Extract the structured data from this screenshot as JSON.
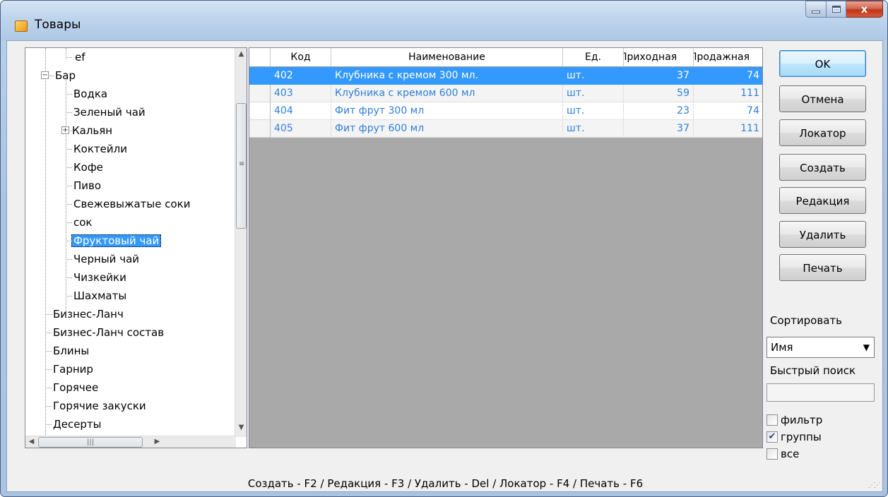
{
  "window": {
    "title": "Товары",
    "controls": {
      "minimize": "–",
      "maximize": "□",
      "close": "x"
    }
  },
  "tree": {
    "nodes": [
      {
        "label": "ef"
      },
      {
        "label": "Бар",
        "expander": "−"
      },
      {
        "label": "Водка"
      },
      {
        "label": "Зеленый чай"
      },
      {
        "label": "Кальян",
        "expander": "+"
      },
      {
        "label": "Коктейли"
      },
      {
        "label": "Кофе"
      },
      {
        "label": "Пиво"
      },
      {
        "label": "Свежевыжатые соки"
      },
      {
        "label": "сок"
      },
      {
        "label": "Фруктовый чай",
        "selected": true
      },
      {
        "label": "Черный чай"
      },
      {
        "label": "Чизкейки"
      },
      {
        "label": "Шахматы"
      },
      {
        "label": "Бизнес-Ланч"
      },
      {
        "label": "Бизнес-Ланч состав"
      },
      {
        "label": "Блины"
      },
      {
        "label": "Гарнир"
      },
      {
        "label": "Горячее"
      },
      {
        "label": "Горячие закуски"
      },
      {
        "label": "Десерты"
      }
    ]
  },
  "grid": {
    "columns": [
      "Код",
      "Наименование",
      "Ед.",
      "Приходная",
      "Продажная"
    ],
    "rows": [
      {
        "code": "402",
        "name": "Клубника  с кремом 300 мл.",
        "unit": "шт.",
        "purchase": "37",
        "sale": "74",
        "selected": true
      },
      {
        "code": "403",
        "name": "Клубника с кремом 600 мл",
        "unit": "шт.",
        "purchase": "59",
        "sale": "111"
      },
      {
        "code": "404",
        "name": "Фит фрут 300 мл",
        "unit": "шт.",
        "purchase": "23",
        "sale": "74"
      },
      {
        "code": "405",
        "name": "Фит фрут 600 мл",
        "unit": "шт.",
        "purchase": "37",
        "sale": "111"
      }
    ]
  },
  "buttons": {
    "ok": "OK",
    "cancel": "Отмена",
    "locator": "Локатор",
    "create": "Создать",
    "edit": "Редакция",
    "delete": "Удалить",
    "print": "Печать"
  },
  "sort": {
    "label": "Сортировать",
    "value": "Имя"
  },
  "quick_search": {
    "label": "Быстрый поиск",
    "value": ""
  },
  "checkboxes": {
    "filter": {
      "label": "фильтр",
      "checked": false
    },
    "groups": {
      "label": "группы",
      "checked": true
    },
    "all": {
      "label": "все",
      "checked": false
    }
  },
  "hint": "Создать - F2 / Редакция - F3 / Удалить - Del / Локатор - F4 / Печать - F6",
  "colors": {
    "selection": "#3399ff",
    "link_text": "#2f7fd8",
    "grid_bg": "#a9a9a9"
  }
}
